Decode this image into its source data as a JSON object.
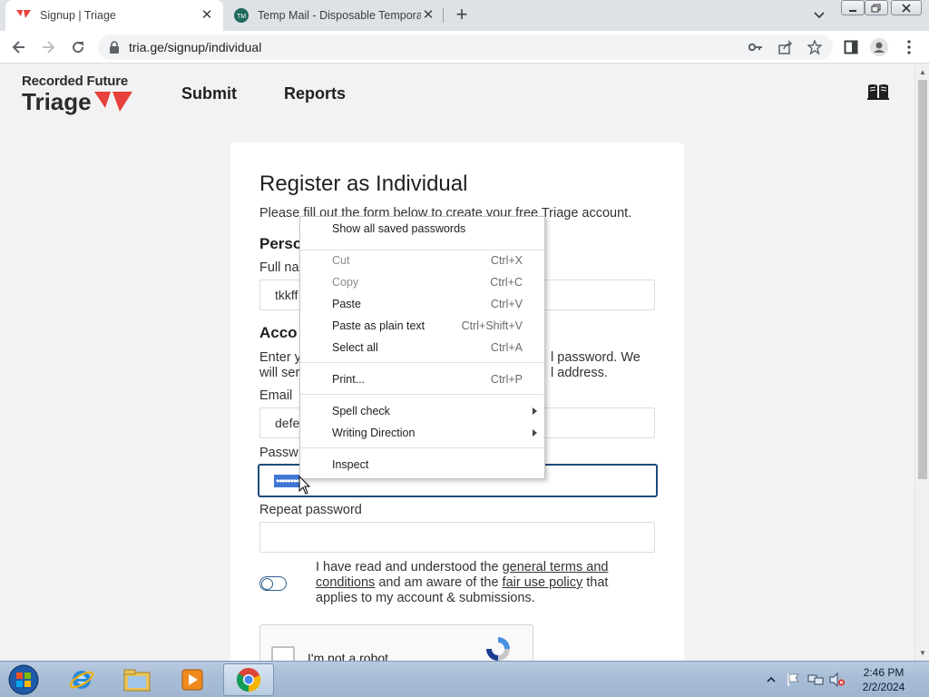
{
  "browser": {
    "tabs": [
      {
        "title": "Signup | Triage",
        "active": true
      },
      {
        "title": "Temp Mail - Disposable Tempora",
        "active": false
      }
    ],
    "url": "tria.ge/signup/individual"
  },
  "site": {
    "logo_top": "Recorded Future",
    "logo_bottom": "Triage",
    "nav": [
      "Submit",
      "Reports"
    ]
  },
  "form": {
    "title": "Register as Individual",
    "intro": "Please fill out the form below to create your free Triage account.",
    "personal_heading": "Perso",
    "fullname_label": "Full na",
    "fullname_value": "tkkff",
    "account_heading": "Acco",
    "account_desc_line1_start": "Enter y",
    "account_desc_line1_end": "l password. We",
    "account_desc_line2_start": "will ser",
    "account_desc_line2_end": "l address.",
    "email_label": "Email",
    "email_value": "defe",
    "password_label": "Passw",
    "password_value": "••••••••",
    "repeat_label": "Repeat password",
    "repeat_value": "",
    "terms_prefix": "I have read and understood the ",
    "terms_link1": "general terms and conditions",
    "terms_mid": " and am aware of the ",
    "terms_link2": "fair use policy",
    "terms_suffix": " that applies to my account & submissions.",
    "captcha_label": "I'm not a robot"
  },
  "context_menu": {
    "items": [
      {
        "label": "Show all saved passwords",
        "shortcut": "",
        "disabled": false
      },
      {
        "label": "Cut",
        "shortcut": "Ctrl+X",
        "disabled": true
      },
      {
        "label": "Copy",
        "shortcut": "Ctrl+C",
        "disabled": true
      },
      {
        "label": "Paste",
        "shortcut": "Ctrl+V",
        "disabled": false
      },
      {
        "label": "Paste as plain text",
        "shortcut": "Ctrl+Shift+V",
        "disabled": false
      },
      {
        "label": "Select all",
        "shortcut": "Ctrl+A",
        "disabled": false
      },
      {
        "label": "Print...",
        "shortcut": "Ctrl+P",
        "disabled": false
      },
      {
        "label": "Spell check",
        "shortcut": "",
        "disabled": false
      },
      {
        "label": "Writing Direction",
        "shortcut": "",
        "disabled": false
      },
      {
        "label": "Inspect",
        "shortcut": "",
        "disabled": false
      }
    ]
  },
  "taskbar": {
    "time": "2:46 PM",
    "date": "2/2/2024",
    "icons": [
      "start-orb",
      "internet-explorer-icon",
      "file-explorer-icon",
      "media-player-icon",
      "chrome-icon"
    ]
  },
  "colors": {
    "brand_red": "#e8403a",
    "focus_border": "#1f4a7a",
    "selection_blue": "#3f76d6"
  }
}
